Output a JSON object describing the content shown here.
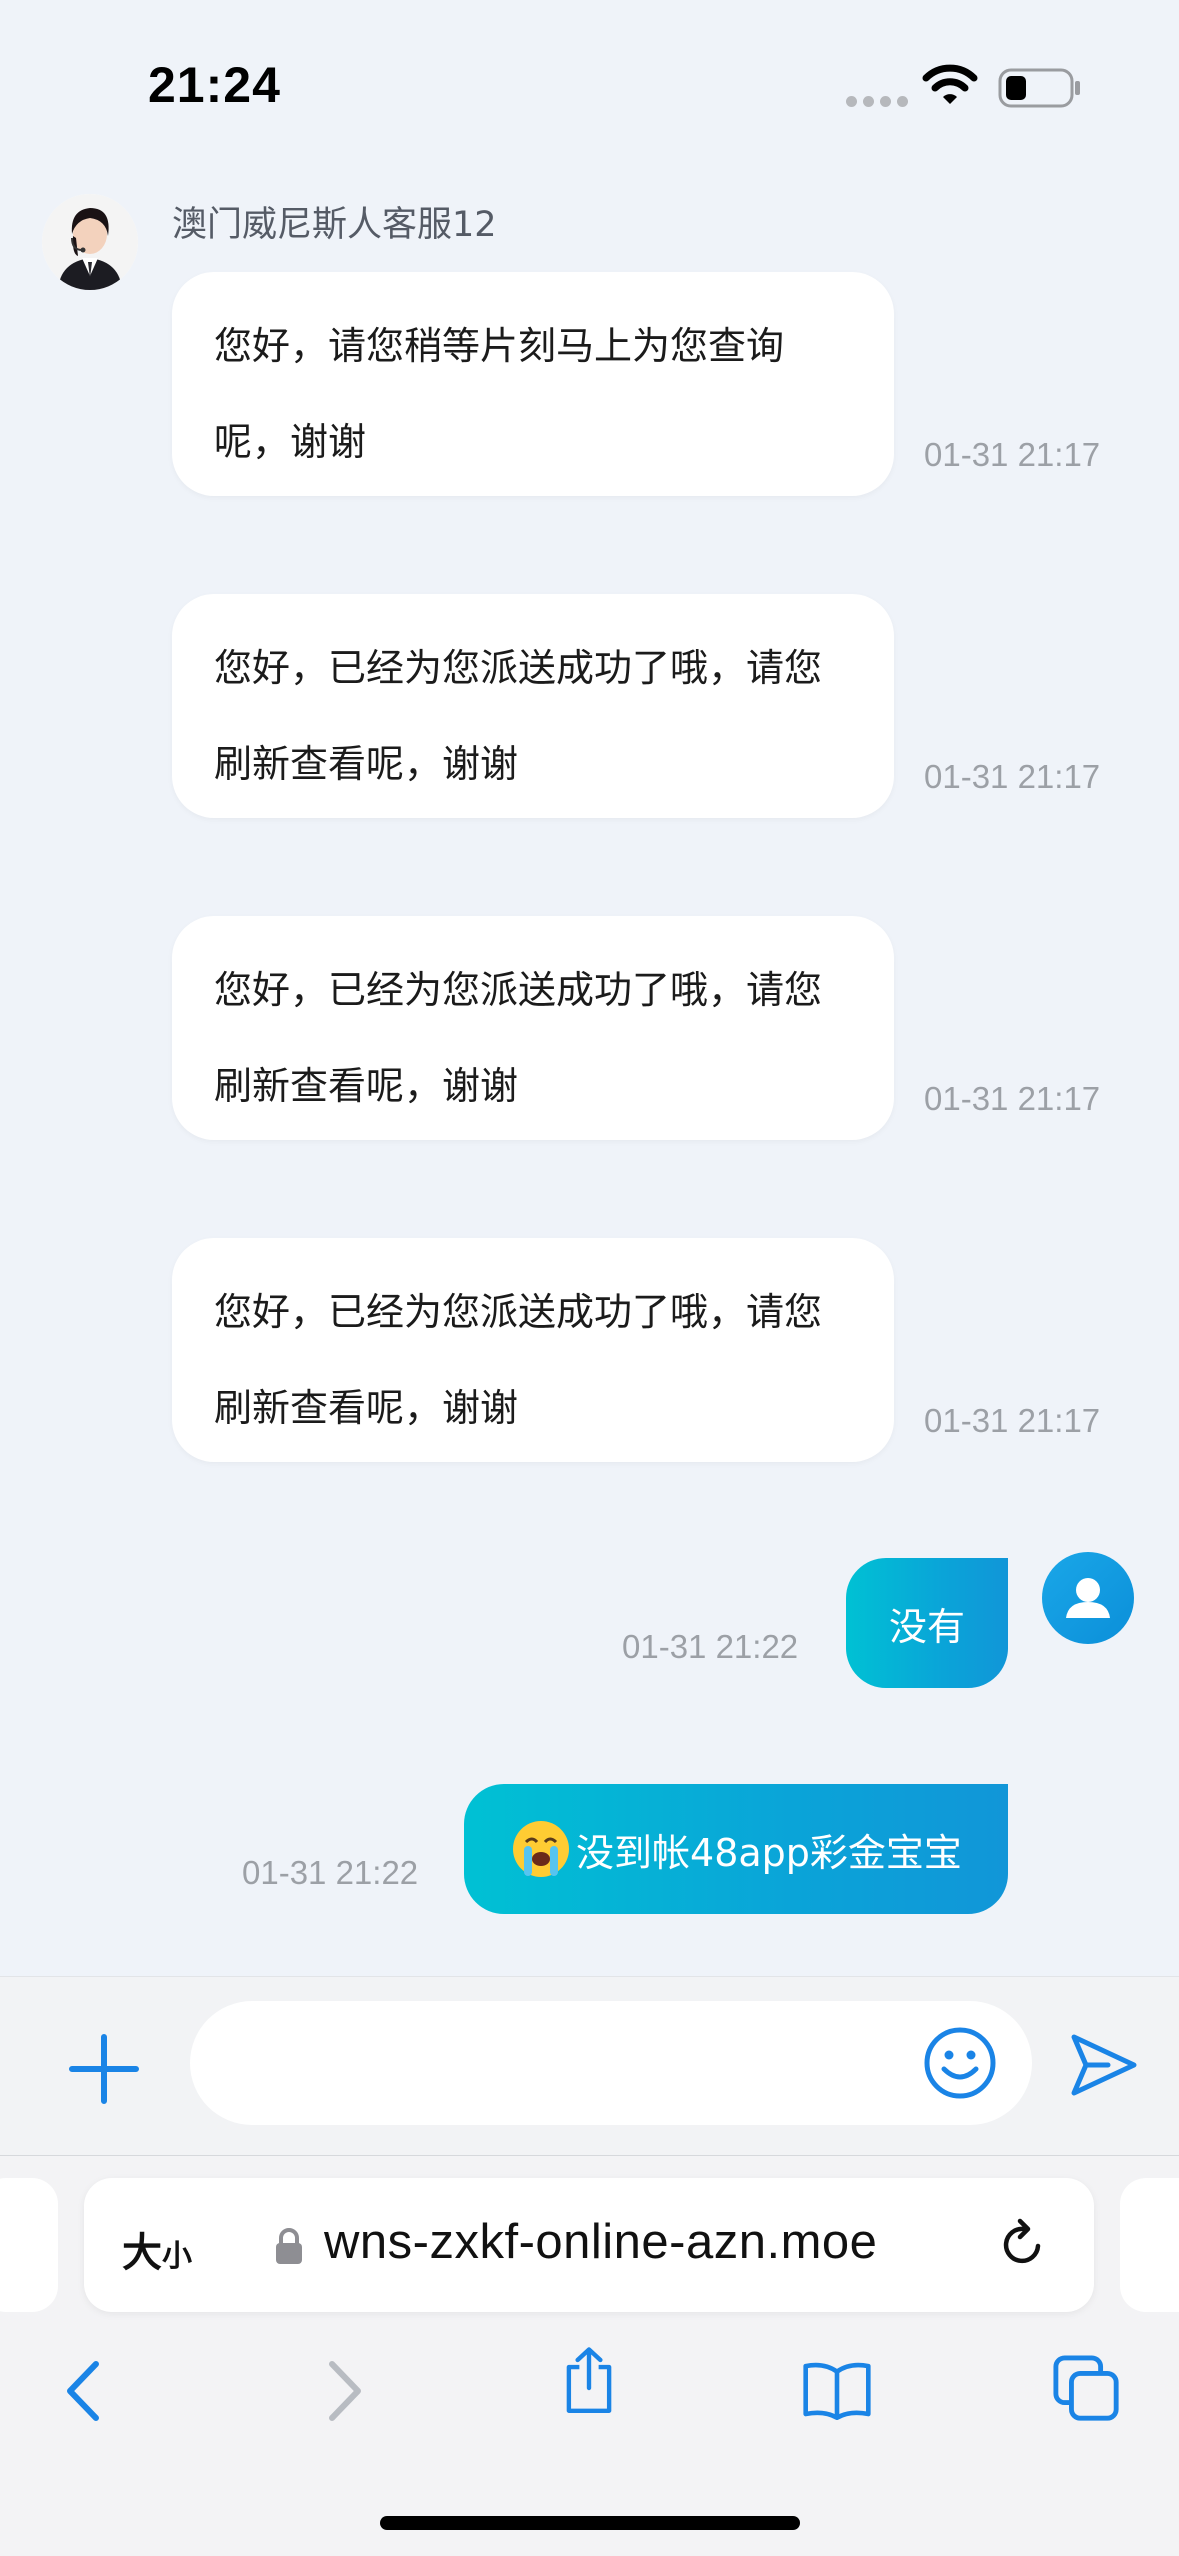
{
  "status_bar": {
    "time": "21:24"
  },
  "chat": {
    "agent_name": "澳门威尼斯人客服12",
    "incoming": [
      {
        "line1": "您好，请您稍等片刻马上为您查询",
        "line2": "呢，谢谢",
        "time": "01-31 21:17"
      },
      {
        "line1": "您好，已经为您派送成功了哦，请您",
        "line2": "刷新查看呢，谢谢",
        "time": "01-31 21:17"
      },
      {
        "line1": "您好，已经为您派送成功了哦，请您",
        "line2": "刷新查看呢，谢谢",
        "time": "01-31 21:17"
      },
      {
        "line1": "您好，已经为您派送成功了哦，请您",
        "line2": "刷新查看呢，谢谢",
        "time": "01-31 21:17"
      }
    ],
    "outgoing": [
      {
        "text": "没有",
        "time": "01-31 21:22"
      },
      {
        "emoji": "crying-face-emoji",
        "text": "没到帐48app彩金宝宝",
        "time": "01-31 21:22"
      }
    ]
  },
  "composer": {
    "message_value": "",
    "icons": [
      "plus-icon",
      "smile-icon",
      "send-icon"
    ]
  },
  "browser": {
    "text_size_big": "大",
    "text_size_small": "小",
    "url": "wns-zxkf-online-azn.moe",
    "accent_color": "#1a84e6"
  },
  "colors": {
    "background": "#eff3f9",
    "outgoing_bubble_start": "#00c1d4",
    "outgoing_bubble_end": "#1196d8"
  }
}
